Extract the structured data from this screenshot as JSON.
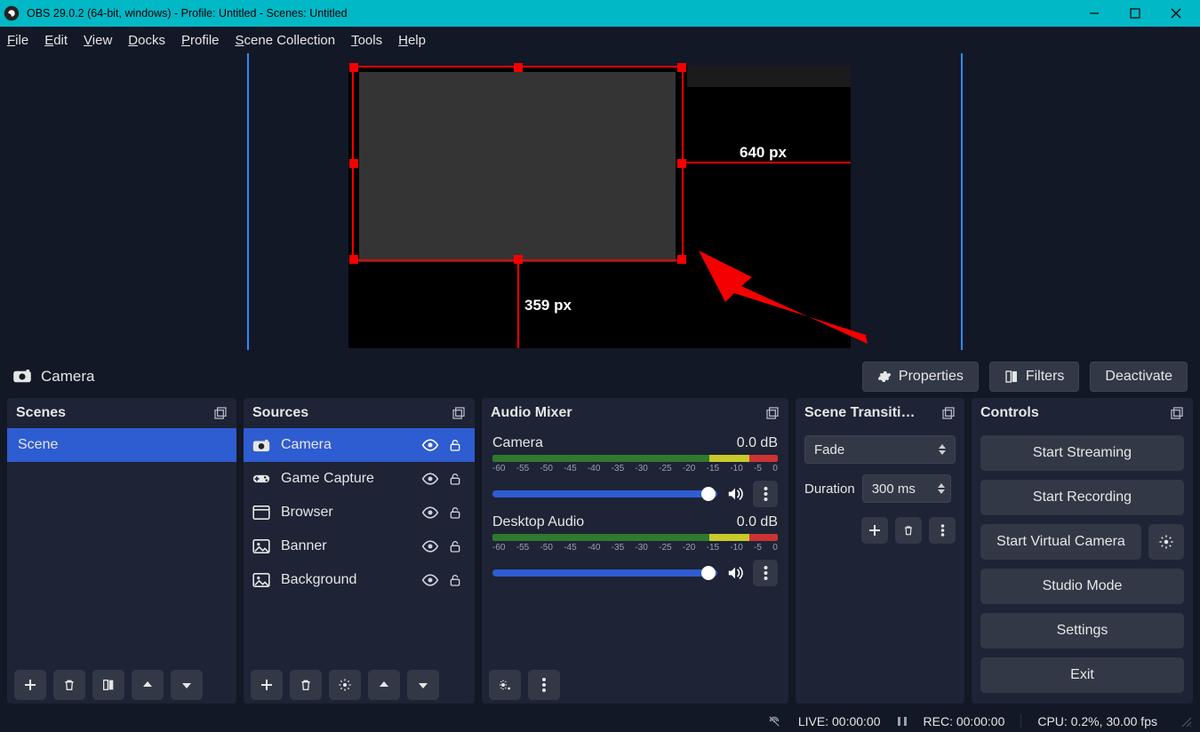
{
  "titlebar": {
    "text": "OBS 29.0.2 (64-bit, windows) - Profile: Untitled - Scenes: Untitled"
  },
  "menu": [
    "File",
    "Edit",
    "View",
    "Docks",
    "Profile",
    "Scene Collection",
    "Tools",
    "Help"
  ],
  "preview": {
    "width_label": "640 px",
    "height_label": "359 px"
  },
  "context_toolbar": {
    "source_name": "Camera",
    "properties": "Properties",
    "filters": "Filters",
    "deactivate": "Deactivate"
  },
  "panels": {
    "scenes_title": "Scenes",
    "sources_title": "Sources",
    "mixer_title": "Audio Mixer",
    "transitions_title": "Scene Transiti…",
    "controls_title": "Controls"
  },
  "scenes": [
    {
      "name": "Scene",
      "selected": true
    }
  ],
  "sources": [
    {
      "name": "Camera",
      "icon": "camera-icon",
      "selected": true
    },
    {
      "name": "Game Capture",
      "icon": "gamepad-icon",
      "selected": false
    },
    {
      "name": "Browser",
      "icon": "browser-icon",
      "selected": false
    },
    {
      "name": "Banner",
      "icon": "image-icon",
      "selected": false
    },
    {
      "name": "Background",
      "icon": "image-icon",
      "selected": false
    }
  ],
  "mixer": {
    "ticks": [
      "-60",
      "-55",
      "-50",
      "-45",
      "-40",
      "-35",
      "-30",
      "-25",
      "-20",
      "-15",
      "-10",
      "-5",
      "0"
    ],
    "channels": [
      {
        "name": "Camera",
        "db": "0.0 dB"
      },
      {
        "name": "Desktop Audio",
        "db": "0.0 dB"
      }
    ]
  },
  "transitions": {
    "selected": "Fade",
    "duration_label": "Duration",
    "duration_value": "300 ms"
  },
  "controls": {
    "start_streaming": "Start Streaming",
    "start_recording": "Start Recording",
    "start_virtual_camera": "Start Virtual Camera",
    "studio_mode": "Studio Mode",
    "settings": "Settings",
    "exit": "Exit"
  },
  "status": {
    "live": "LIVE: 00:00:00",
    "rec": "REC: 00:00:00",
    "cpu": "CPU: 0.2%, 30.00 fps"
  }
}
